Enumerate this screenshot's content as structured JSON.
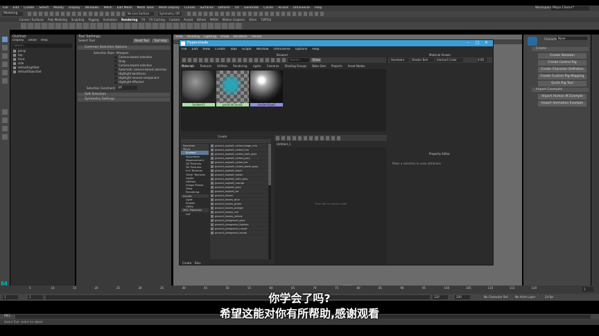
{
  "app": {
    "mode": "Modeling",
    "menus": [
      "File",
      "Edit",
      "Create",
      "Select",
      "Modify",
      "Display",
      "Windows",
      "Mesh",
      "Edit Mesh",
      "Mesh Tools",
      "Mesh Display",
      "Curves",
      "Surfaces",
      "Deform",
      "UV",
      "Generate",
      "Cache",
      "Arnold",
      "Omniverse",
      "Help"
    ],
    "workspace_label": "Workspace:",
    "workspace_value": "Maya Classic*",
    "live_surface": "No Live Surface",
    "symmetry": "Symmetry: Off",
    "shelf_tabs": [
      "Curves / Surfaces",
      "Poly Modeling",
      "Sculpting",
      "Rigging",
      "Animation",
      "Rendering",
      "FX",
      "FX Caching",
      "Custom",
      "Arnold",
      "Bifrost",
      "MASH",
      "Motion Graphics",
      "XGen",
      "TURTLE"
    ],
    "active_shelf_tab": "Rendering"
  },
  "outliner": {
    "title": "Outliner",
    "menus": [
      "Display",
      "Show",
      "Help"
    ],
    "search_placeholder": "Search...",
    "items": [
      "persp",
      "top",
      "front",
      "side",
      "defaultLightSet",
      "defaultObjectSet"
    ]
  },
  "tool_settings": {
    "title": "Tool Settings",
    "subtitle": "Select Tool",
    "reset_label": "Reset Tool",
    "help_label": "Tool Help",
    "section": "Common Selection Options",
    "style_label": "Selection Style:",
    "style_value": "Marquee",
    "options": [
      "Camera based selection",
      "Drag",
      "Camera based selection",
      "Automatic camera-based selection",
      "Highlight backfaces",
      "Highlight nearest component",
      "Highlight Affected"
    ],
    "constraint_label": "Selection Constraint:",
    "constraint_value": "Off",
    "sections": [
      "Soft Selection",
      "Symmetry Settings"
    ]
  },
  "hypershade": {
    "title": "Hypershade",
    "menus": [
      "File",
      "Edit",
      "View",
      "Create",
      "Tabs",
      "Graph",
      "Window",
      "Omniverse",
      "Options",
      "Help"
    ],
    "browser_label": "Browser",
    "browser_tabs": [
      "Materials",
      "Textures",
      "Utilities",
      "Rendering",
      "Lights",
      "Cameras",
      "Shading Groups",
      "Bake Sets",
      "Projects",
      "Asset Nodes"
    ],
    "search_placeholder": "Search...",
    "show_label": "Show",
    "materials": [
      {
        "name": "lambert1",
        "color": "#a6e3a1"
      },
      {
        "name": "particleCloud1",
        "color": "#a6e3a1"
      },
      {
        "name": "shaderGlow1",
        "color": "#8f8fe6"
      }
    ],
    "create_label": "Create",
    "tree": [
      {
        "label": "Favorites",
        "type": "head"
      },
      {
        "label": "Maya",
        "type": "head"
      },
      {
        "label": "Surface",
        "type": "sel"
      },
      {
        "label": "Volumetric",
        "type": "row"
      },
      {
        "label": "Displacement",
        "type": "row"
      },
      {
        "label": "2D Textures",
        "type": "row"
      },
      {
        "label": "3D Textures",
        "type": "row"
      },
      {
        "label": "Env Textures",
        "type": "row"
      },
      {
        "label": "Other Textures",
        "type": "row"
      },
      {
        "label": "Lights",
        "type": "row"
      },
      {
        "label": "Utilities",
        "type": "row"
      },
      {
        "label": "Image Planes",
        "type": "row"
      },
      {
        "label": "Glow",
        "type": "row"
      },
      {
        "label": "Rendering",
        "type": "row"
      },
      {
        "label": "Arnold",
        "type": "head"
      },
      {
        "label": "Light",
        "type": "row"
      },
      {
        "label": "Shader",
        "type": "row"
      },
      {
        "label": "Utility",
        "type": "row"
      },
      {
        "label": "MDL Materials",
        "type": "head"
      },
      {
        "label": "AxF",
        "type": "row"
      }
    ],
    "node_list": [
      "ground_asphalt_rutted_beige_mix",
      "ground_asphalt_rutted_mix",
      "ground_asphalt_rutted_dark_gray",
      "ground_asphalt_rutted_gray",
      "ground_asphalt_rutted_tar",
      "ground_asphalt_rutted_warm_gray",
      "ground_asphalt_black",
      "ground_asphalt_brown",
      "ground_asphalt_dark_gray",
      "ground_asphalt_orange",
      "ground_asphalt_gray",
      "ground_asphalt_tar",
      "ground_leaves",
      "ground_leaves_blue",
      "ground_leaves_green",
      "ground_leaves_orange",
      "ground_leaves_red",
      "ground_leaves_yellow",
      "ground_pinegravel_gray",
      "ground_pinegravel_lightslo",
      "ground_pinegravel_russet",
      "ground_pinegravel_sandy"
    ],
    "bottom_tabs": [
      "Create",
      "Bins"
    ],
    "graph_tab": "Untitled_1",
    "graph_hint": "Press Tab to create a node",
    "material_viewer": "Material Viewer",
    "viewer_renderer": "Hardware",
    "viewer_shape": "Shader Ball",
    "viewer_env": "Interior1 Color",
    "viewer_value": "0.00",
    "property_editor": "Property Editor",
    "property_hint": "Make a selection to view attributes"
  },
  "viewport": {
    "menus": [
      "View",
      "Shading",
      "Lighting",
      "Show",
      "Renderer",
      "Panels"
    ],
    "camera_label": "persp"
  },
  "character_sets": {
    "char_label": "Character:",
    "char_value": "None",
    "create_header": "Create",
    "create_buttons": [
      "Create Skeleton",
      "Create Control Rig",
      "Create Character Definition",
      "Create Custom Rig Mapping",
      "Quick Rig Tool"
    ],
    "import_header": "Import Examples",
    "import_buttons": [
      "Import Human IK Example",
      "Import Animation Example"
    ],
    "side_tabs": [
      "Modeling Toolkit",
      "Attribute Editor",
      "Channel Box / Layer Editor",
      "Character Controls",
      "Channel Control"
    ]
  },
  "timeline": {
    "ticks": [
      "5",
      "10",
      "15",
      "20",
      "25",
      "30",
      "35",
      "40",
      "45",
      "50",
      "55",
      "60",
      "65",
      "70",
      "75",
      "80",
      "85",
      "90",
      "95",
      "100",
      "105",
      "110",
      "115",
      "120"
    ],
    "start": "1",
    "end": "120",
    "range_end": "200",
    "char_set": "No Character Set",
    "anim_layer": "No Anim Layer",
    "fps": "24 fps",
    "current": "1"
  },
  "status": {
    "mel_label": "MEL",
    "help_text": "Select Tool: select an object"
  },
  "subtitles": {
    "line1": "你学会了吗?",
    "line2": "希望这能对你有所帮助,感谢观看"
  }
}
